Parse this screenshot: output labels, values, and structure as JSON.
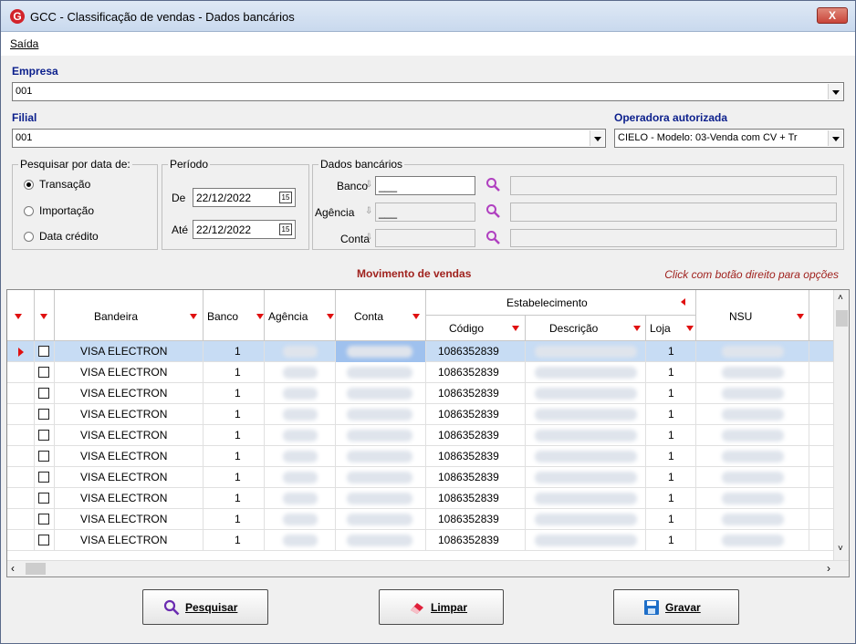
{
  "window": {
    "title": "GCC - Classificação de vendas - Dados bancários",
    "logo_letter": "G",
    "close_label": "X"
  },
  "menu": {
    "saida": "Saída"
  },
  "empresa": {
    "label": "Empresa",
    "value": "001"
  },
  "filial": {
    "label": "Filial",
    "value": "001"
  },
  "operadora": {
    "label": "Operadora autorizada",
    "value": "CIELO - Modelo: 03-Venda com CV + Tr"
  },
  "pesquisar": {
    "title": "Pesquisar por data de:",
    "options": [
      "Transação",
      "Importação",
      "Data crédito"
    ],
    "selected": "Transação"
  },
  "periodo": {
    "title": "Período",
    "de_label": "De",
    "de_value": "22/12/2022",
    "ate_label": "Até",
    "ate_value": "22/12/2022",
    "cal_icon": "15"
  },
  "dados": {
    "title": "Dados bancários",
    "banco_label": "Banco",
    "banco_value": "___",
    "agencia_label": "Agência",
    "agencia_value": "___",
    "conta_label": "Conta"
  },
  "grid": {
    "title": "Movimento de vendas",
    "hint": "Click com botão direito para opções",
    "headers": {
      "bandeira": "Bandeira",
      "banco": "Banco",
      "agencia": "Agência",
      "conta": "Conta",
      "estabelecimento": "Estabelecimento",
      "codigo": "Código",
      "descricao": "Descrição",
      "loja": "Loja",
      "nsu": "NSU"
    },
    "rows": [
      {
        "bandeira": "VISA ELECTRON",
        "banco": "1",
        "codigo": "1086352839",
        "loja": "1"
      },
      {
        "bandeira": "VISA ELECTRON",
        "banco": "1",
        "codigo": "1086352839",
        "loja": "1"
      },
      {
        "bandeira": "VISA ELECTRON",
        "banco": "1",
        "codigo": "1086352839",
        "loja": "1"
      },
      {
        "bandeira": "VISA ELECTRON",
        "banco": "1",
        "codigo": "1086352839",
        "loja": "1"
      },
      {
        "bandeira": "VISA ELECTRON",
        "banco": "1",
        "codigo": "1086352839",
        "loja": "1"
      },
      {
        "bandeira": "VISA ELECTRON",
        "banco": "1",
        "codigo": "1086352839",
        "loja": "1"
      },
      {
        "bandeira": "VISA ELECTRON",
        "banco": "1",
        "codigo": "1086352839",
        "loja": "1"
      },
      {
        "bandeira": "VISA ELECTRON",
        "banco": "1",
        "codigo": "1086352839",
        "loja": "1"
      },
      {
        "bandeira": "VISA ELECTRON",
        "banco": "1",
        "codigo": "1086352839",
        "loja": "1"
      },
      {
        "bandeira": "VISA ELECTRON",
        "banco": "1",
        "codigo": "1086352839",
        "loja": "1"
      }
    ]
  },
  "buttons": {
    "pesquisar": "Pesquisar",
    "limpar": "Limpar",
    "gravar": "Gravar"
  },
  "colors": {
    "label_blue": "#0b1f8c",
    "grid_title_red": "#a0221e",
    "filter_red": "#e01010",
    "selected_row": "#c7dcf4"
  }
}
